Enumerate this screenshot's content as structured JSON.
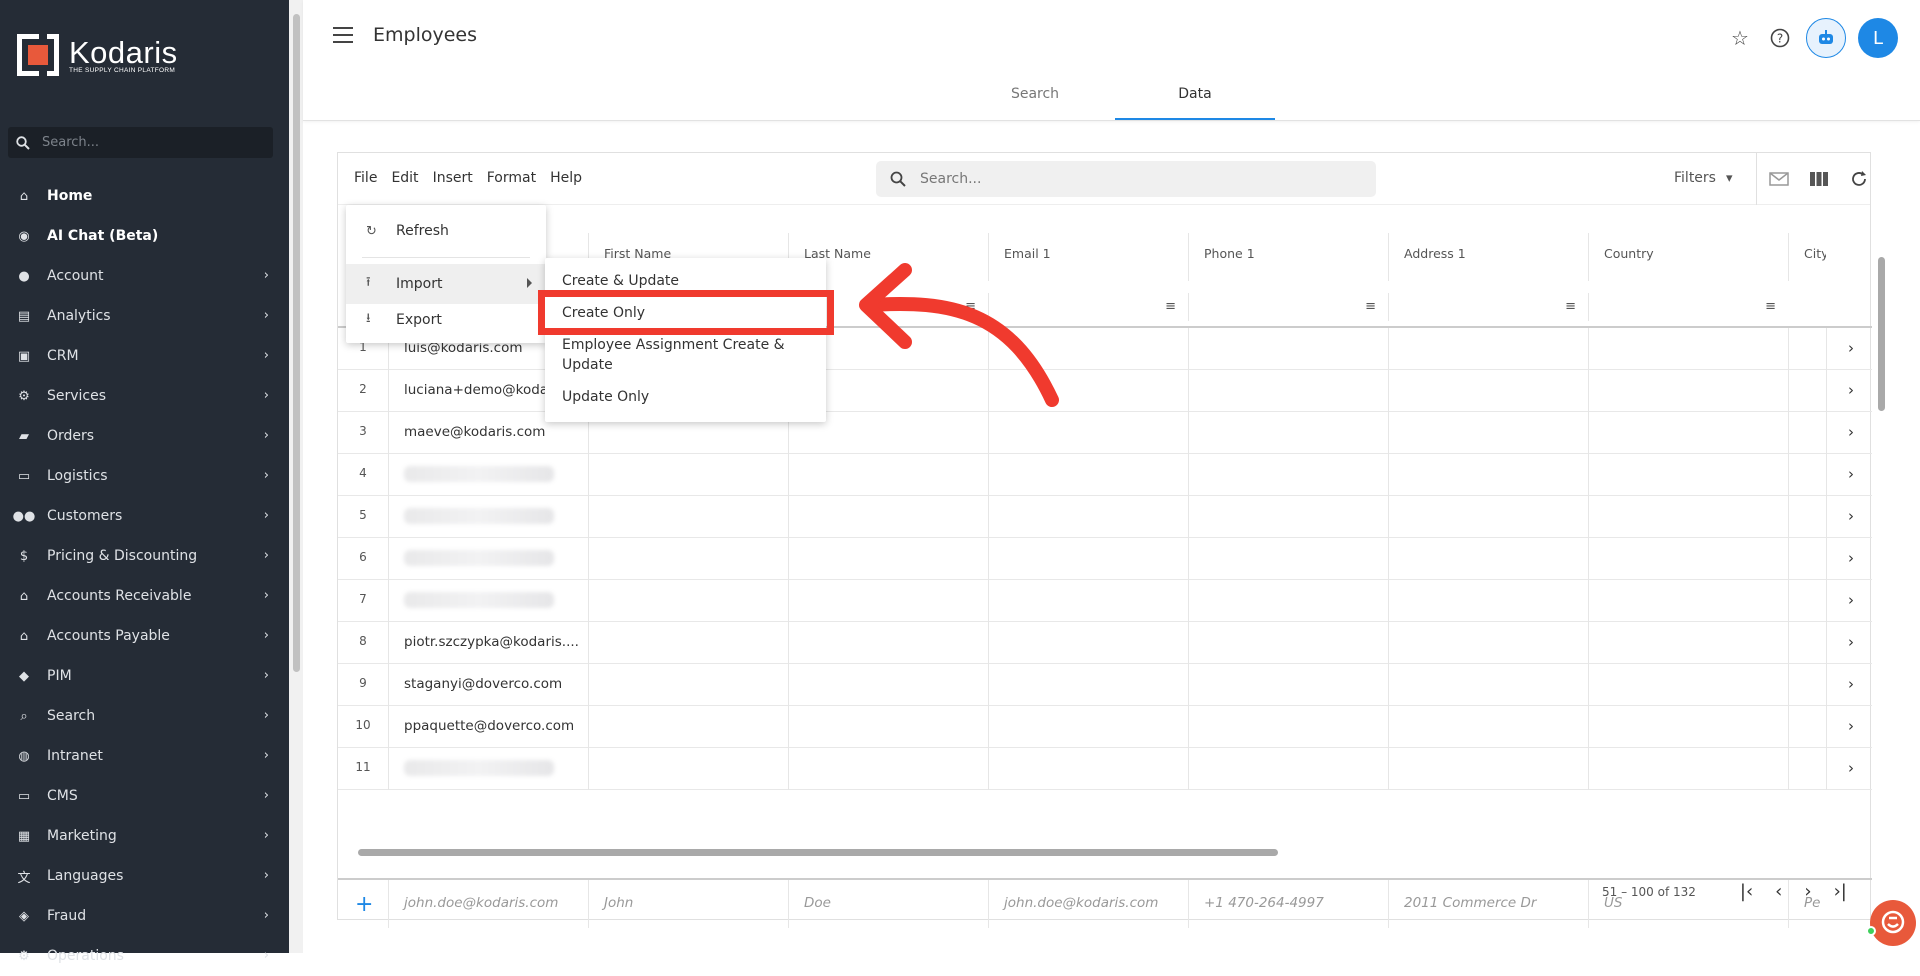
{
  "brand": {
    "name": "Kodaris",
    "tagline": "THE SUPPLY CHAIN PLATFORM"
  },
  "sidebar": {
    "search_placeholder": "Search...",
    "items": [
      {
        "label": "Home",
        "icon": "home-icon",
        "bold": true,
        "chevron": false
      },
      {
        "label": "AI Chat (Beta)",
        "icon": "robot-icon",
        "bold": true,
        "chevron": false
      },
      {
        "label": "Account",
        "icon": "person-icon",
        "chevron": true
      },
      {
        "label": "Analytics",
        "icon": "analytics-icon",
        "chevron": true
      },
      {
        "label": "CRM",
        "icon": "crm-icon",
        "chevron": true
      },
      {
        "label": "Services",
        "icon": "services-icon",
        "chevron": true
      },
      {
        "label": "Orders",
        "icon": "truck-icon",
        "chevron": true
      },
      {
        "label": "Logistics",
        "icon": "logistics-icon",
        "chevron": true
      },
      {
        "label": "Customers",
        "icon": "people-icon",
        "chevron": true
      },
      {
        "label": "Pricing & Discounting",
        "icon": "dollar-icon",
        "chevron": true
      },
      {
        "label": "Accounts Receivable",
        "icon": "bank-icon",
        "chevron": true
      },
      {
        "label": "Accounts Payable",
        "icon": "bank-icon",
        "chevron": true
      },
      {
        "label": "PIM",
        "icon": "tag-icon",
        "chevron": true
      },
      {
        "label": "Search",
        "icon": "search-icon",
        "chevron": true
      },
      {
        "label": "Intranet",
        "icon": "globe-icon",
        "chevron": true
      },
      {
        "label": "CMS",
        "icon": "cms-icon",
        "chevron": true
      },
      {
        "label": "Marketing",
        "icon": "marketing-icon",
        "chevron": true
      },
      {
        "label": "Languages",
        "icon": "translate-icon",
        "chevron": true
      },
      {
        "label": "Fraud",
        "icon": "shield-icon",
        "chevron": true
      },
      {
        "label": "Operations",
        "icon": "gear-icon",
        "chevron": true
      }
    ]
  },
  "header": {
    "title": "Employees",
    "tabs": [
      {
        "label": "Search",
        "active": false
      },
      {
        "label": "Data",
        "active": true
      }
    ],
    "avatar_initial": "L"
  },
  "toolbar": {
    "menus": [
      "File",
      "Edit",
      "Insert",
      "Format",
      "Help"
    ],
    "search_placeholder": "Search...",
    "filters_label": "Filters"
  },
  "table": {
    "columns": [
      "",
      "First Name",
      "Last Name",
      "Email 1",
      "Phone 1",
      "Address 1",
      "Country",
      "City"
    ],
    "rows": [
      {
        "num": "1",
        "login": "luis@kodaris.com",
        "blurred": false
      },
      {
        "num": "2",
        "login": "luciana+demo@kodaris.com",
        "blurred": false
      },
      {
        "num": "3",
        "login": "maeve@kodaris.com",
        "blurred": false
      },
      {
        "num": "4",
        "login": "",
        "blurred": true
      },
      {
        "num": "5",
        "login": "",
        "blurred": true
      },
      {
        "num": "6",
        "login": "",
        "blurred": true
      },
      {
        "num": "7",
        "login": "",
        "blurred": true
      },
      {
        "num": "8",
        "login": "piotr.szczypka@kodaris....",
        "blurred": false
      },
      {
        "num": "9",
        "login": "staganyi@doverco.com",
        "blurred": false
      },
      {
        "num": "10",
        "login": "ppaquette@doverco.com",
        "blurred": false
      },
      {
        "num": "11",
        "login": "",
        "blurred": true
      }
    ],
    "new_row": {
      "login": "john.doe@kodaris.com",
      "first_name": "John",
      "last_name": "Doe",
      "email": "john.doe@kodaris.com",
      "phone": "+1 470-264-4997",
      "address": "2011 Commerce Dr",
      "country": "US",
      "city": "Pe"
    },
    "pagination": "51 – 100 of 132"
  },
  "file_menu": {
    "items": [
      {
        "label": "Refresh",
        "icon": "refresh-icon"
      },
      {
        "label": "Import",
        "icon": "upload-icon",
        "submenu": true
      },
      {
        "label": "Export",
        "icon": "download-icon"
      }
    ]
  },
  "import_submenu": {
    "items": [
      "Create & Update",
      "Create Only",
      "Employee Assignment Create & Update",
      "Update Only"
    ]
  },
  "colors": {
    "sidebar_bg": "#252c36",
    "accent": "#1e88e5",
    "callout": "#f03a2e"
  }
}
